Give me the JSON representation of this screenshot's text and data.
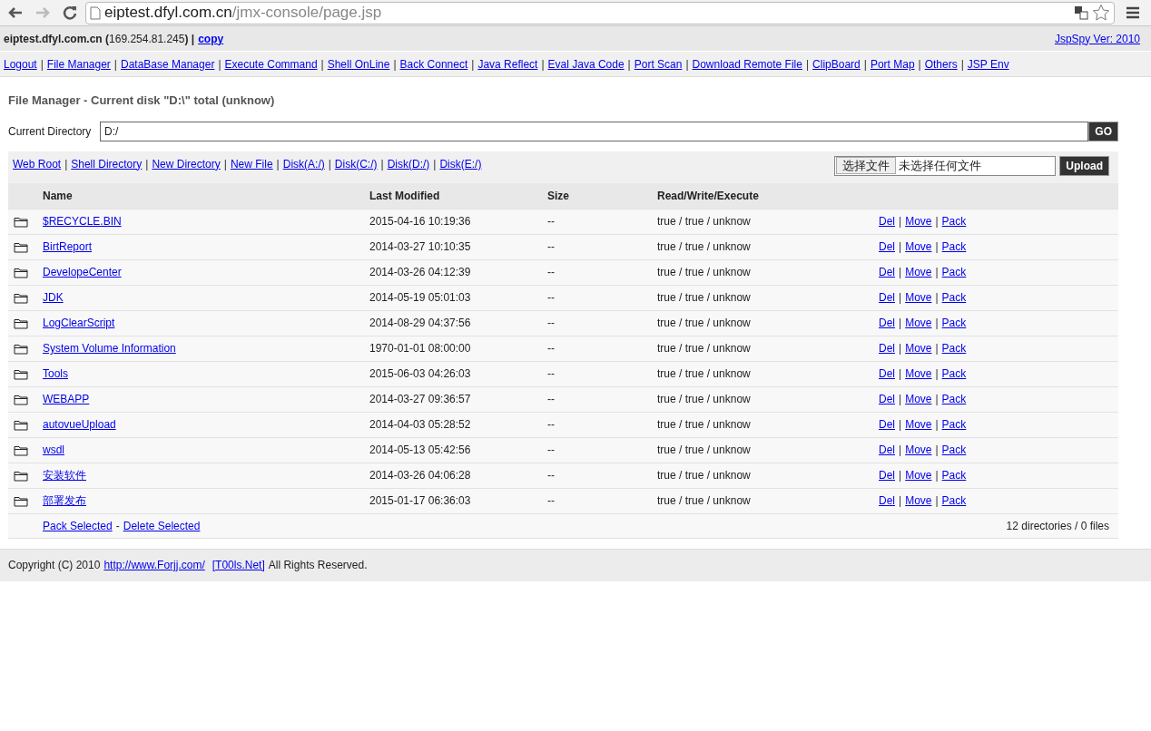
{
  "browser": {
    "url_host": "eiptest.dfyl.com.cn",
    "url_path": "/jmx-console/page.jsp"
  },
  "host_bar": {
    "info": "**eiptest.dfyl.com.cn (**169.254.81.245**) |**",
    "copy_link": "copy",
    "version_link": "JspSpy Ver: 2010"
  },
  "nav": {
    "separator": "|",
    "links": [
      "Logout",
      "File Manager",
      "DataBase Manager",
      "Execute Command",
      "Shell OnLine",
      "Back Connect",
      "Java Reflect",
      "Eval Java Code",
      "Port Scan",
      "Download Remote File",
      "ClipBoard",
      "Port Map",
      "Others",
      "JSP Env"
    ]
  },
  "title": "File Manager - Current disk \"D:\\\" total (unknow)",
  "directory": {
    "label": "Current Directory",
    "value": "D:/",
    "go_button": "GO"
  },
  "toolbar": {
    "links": [
      "Web Root",
      "Shell Directory",
      "New Directory",
      "New File",
      "Disk(A:/)",
      "Disk(C:/)",
      "Disk(D:/)",
      "Disk(E:/)"
    ],
    "choose_file_button": "选择文件",
    "no_file_text": "未选择任何文件",
    "upload_button": "Upload"
  },
  "table": {
    "columns": [
      "Name",
      "Last Modified",
      "Size",
      "Read/Write/Execute"
    ],
    "rows": [
      {
        "name": "$RECYCLE.BIN",
        "modified": "2015-04-16 10:19:36",
        "size": "--",
        "rwx": "true / true / unknow",
        "actions": [
          "Del",
          "Move",
          "Pack"
        ]
      },
      {
        "name": "BirtReport",
        "modified": "2014-03-27 10:10:35",
        "size": "--",
        "rwx": "true / true / unknow",
        "actions": [
          "Del",
          "Move",
          "Pack"
        ]
      },
      {
        "name": "DevelopeCenter",
        "modified": "2014-03-26 04:12:39",
        "size": "--",
        "rwx": "true / true / unknow",
        "actions": [
          "Del",
          "Move",
          "Pack"
        ]
      },
      {
        "name": "JDK",
        "modified": "2014-05-19 05:01:03",
        "size": "--",
        "rwx": "true / true / unknow",
        "actions": [
          "Del",
          "Move",
          "Pack"
        ]
      },
      {
        "name": "LogClearScript",
        "modified": "2014-08-29 04:37:56",
        "size": "--",
        "rwx": "true / true / unknow",
        "actions": [
          "Del",
          "Move",
          "Pack"
        ]
      },
      {
        "name": "System Volume Information",
        "modified": "1970-01-01 08:00:00",
        "size": "--",
        "rwx": "true / true / unknow",
        "actions": [
          "Del",
          "Move",
          "Pack"
        ]
      },
      {
        "name": "Tools",
        "modified": "2015-06-03 04:26:03",
        "size": "--",
        "rwx": "true / true / unknow",
        "actions": [
          "Del",
          "Move",
          "Pack"
        ]
      },
      {
        "name": "WEBAPP",
        "modified": "2014-03-27 09:36:57",
        "size": "--",
        "rwx": "true / true / unknow",
        "actions": [
          "Del",
          "Move",
          "Pack"
        ]
      },
      {
        "name": "autovueUpload",
        "modified": "2014-04-03 05:28:52",
        "size": "--",
        "rwx": "true / true / unknow",
        "actions": [
          "Del",
          "Move",
          "Pack"
        ]
      },
      {
        "name": "wsdl",
        "modified": "2014-05-13 05:42:56",
        "size": "--",
        "rwx": "true / true / unknow",
        "actions": [
          "Del",
          "Move",
          "Pack"
        ]
      },
      {
        "name": "安装软件",
        "modified": "2014-03-26 04:06:28",
        "size": "--",
        "rwx": "true / true / unknow",
        "actions": [
          "Del",
          "Move",
          "Pack"
        ]
      },
      {
        "name": "部署发布",
        "modified": "2015-01-17 06:36:03",
        "size": "--",
        "rwx": "true / true / unknow",
        "actions": [
          "Del",
          "Move",
          "Pack"
        ]
      }
    ],
    "footer": {
      "pack_selected": "Pack Selected",
      "joiner": "-",
      "delete_selected": "Delete Selected",
      "summary": "12 directories / 0 files"
    }
  },
  "copyright": {
    "text": "Copyright (C) 2010",
    "link": "http://www.Forjj.com/",
    "tools_link": "[T00ls.Net]",
    "rights": "All Rights Reserved."
  }
}
